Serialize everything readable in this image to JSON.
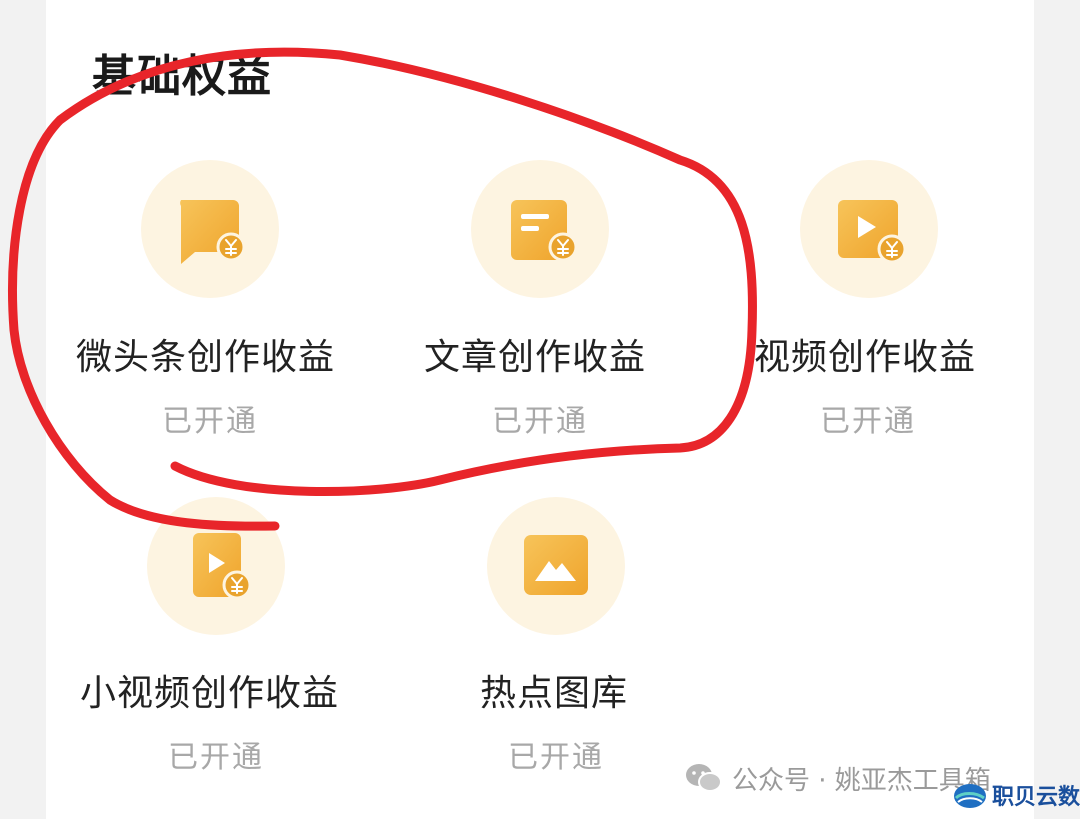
{
  "section": {
    "title": "基础权益"
  },
  "benefits": [
    {
      "label": "微头条创作收益",
      "status": "已开通",
      "icon": "comment-yuan-icon"
    },
    {
      "label": "文章创作收益",
      "status": "已开通",
      "icon": "article-yuan-icon"
    },
    {
      "label": "视频创作收益",
      "status": "已开通",
      "icon": "video-yuan-icon"
    },
    {
      "label": "小视频创作收益",
      "status": "已开通",
      "icon": "short-video-yuan-icon"
    },
    {
      "label": "热点图库",
      "status": "已开通",
      "icon": "image-gallery-icon"
    }
  ],
  "colors": {
    "icon_gold": "#f3b23a",
    "icon_bg": "#fdf4e1",
    "annotation_red": "#e8252a",
    "status_gray": "#a8a8a8"
  },
  "watermark": {
    "text": "公众号 · 姚亚杰工具箱",
    "logo_text": "职贝云数"
  }
}
